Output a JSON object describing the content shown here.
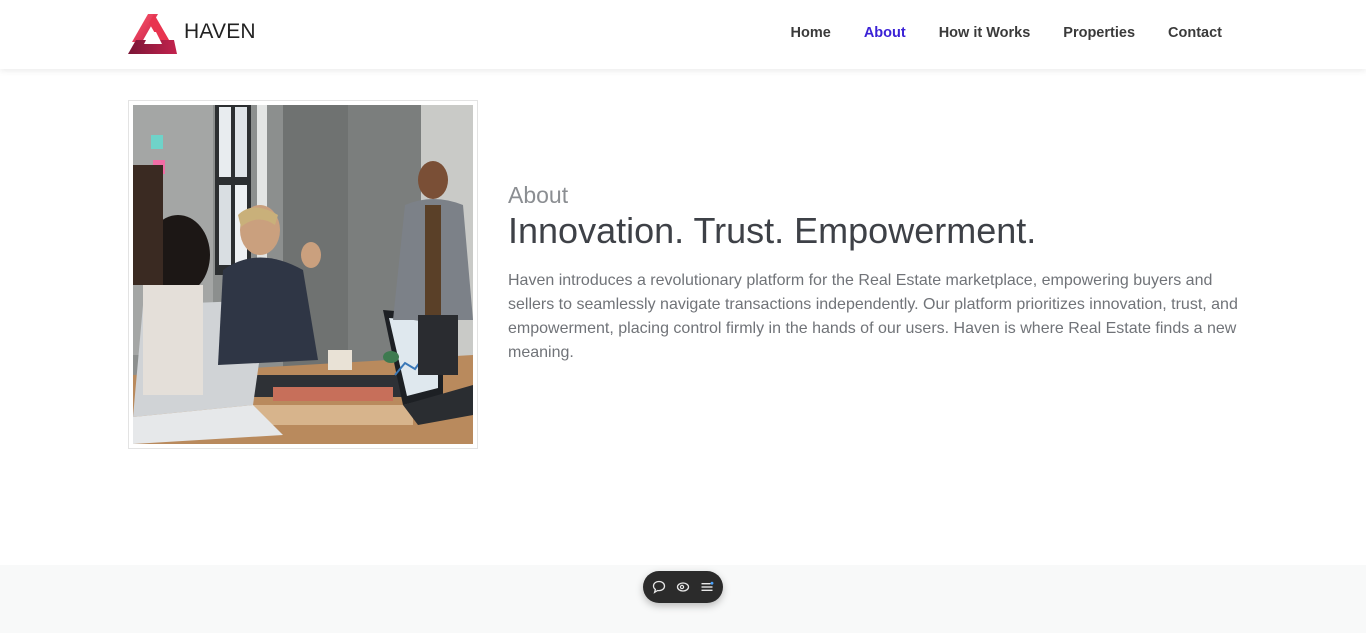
{
  "brand": {
    "name": "HAVEN",
    "logo": "haven-triangle-logo"
  },
  "nav": {
    "items": [
      {
        "label": "Home",
        "active": false
      },
      {
        "label": "About",
        "active": true
      },
      {
        "label": "How it Works",
        "active": false
      },
      {
        "label": "Properties",
        "active": false
      },
      {
        "label": "Contact",
        "active": false
      }
    ]
  },
  "about": {
    "eyebrow": "About",
    "headline": "Innovation. Trust. Empowerment.",
    "body": "Haven introduces a revolutionary platform for the Real Estate marketplace, empowering buyers and sellers to seamlessly navigate transactions independently. Our platform prioritizes innovation, trust, and empowerment, placing control firmly in the hands of our users. Haven is where Real Estate finds a new meaning.",
    "image": "team-meeting-photo"
  },
  "toolbar": {
    "icons": [
      "comment-icon",
      "view-icon",
      "menu-icon"
    ]
  },
  "colors": {
    "accent": "#3b22d6",
    "logo_primary": "#e0344f",
    "logo_dark": "#9c1d43",
    "toolbar_bg": "#2b2b2b"
  }
}
